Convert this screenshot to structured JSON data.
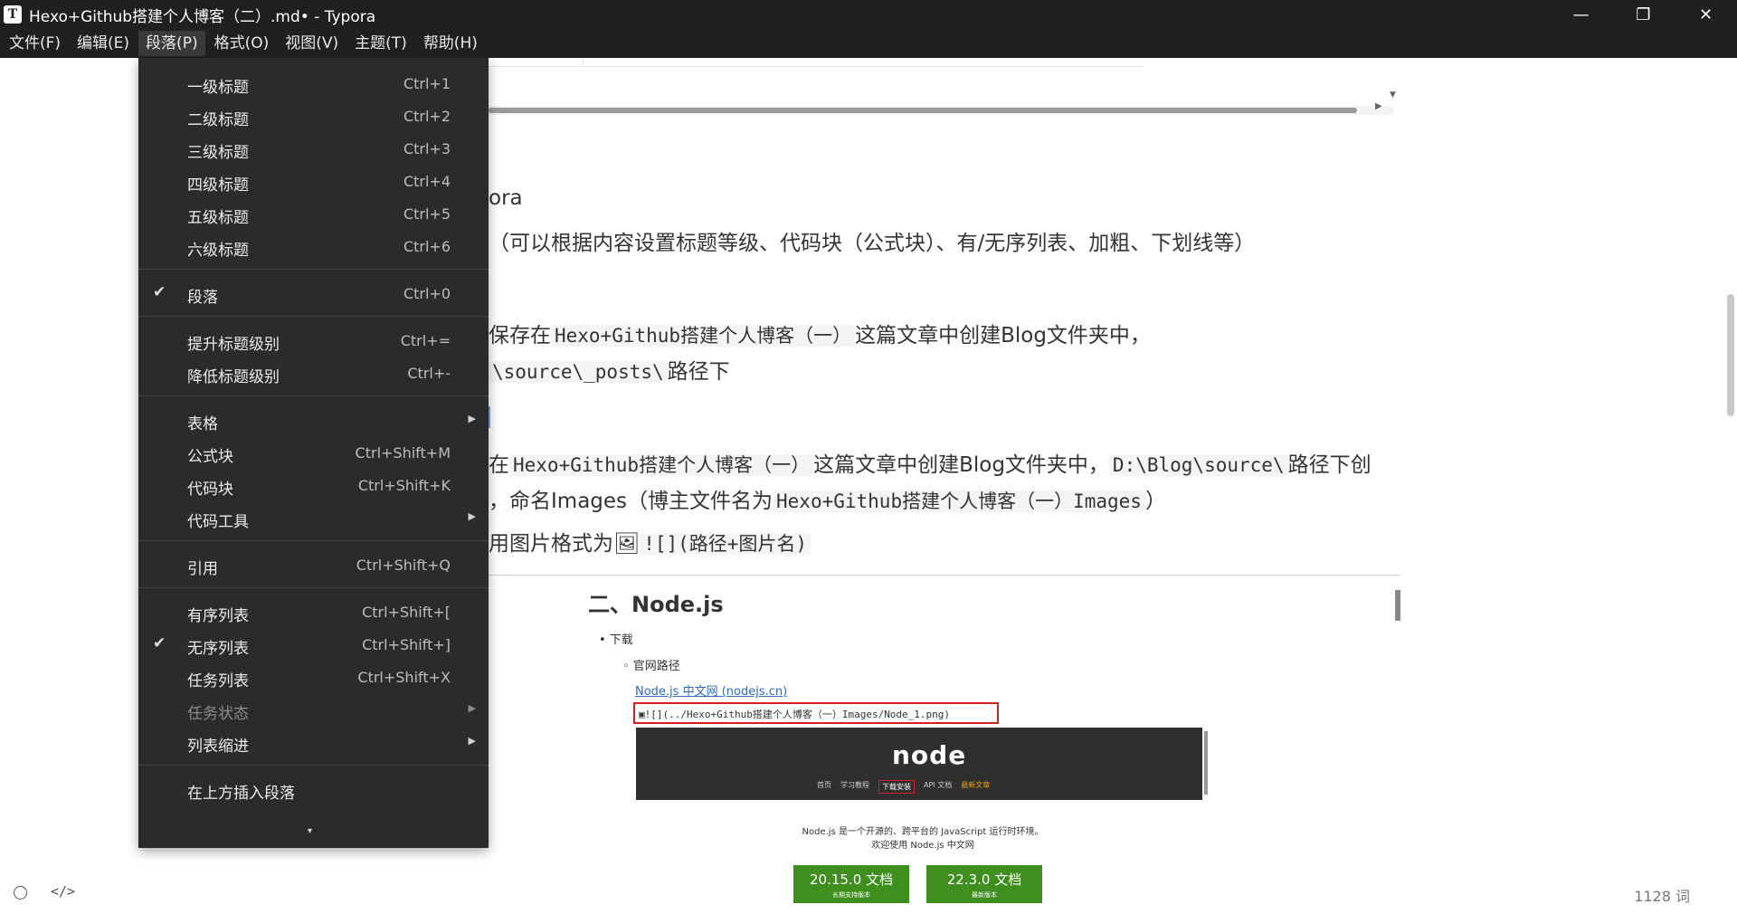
{
  "window": {
    "title": "Hexo+Github搭建个人博客（二）.md• - Typora",
    "app_icon": "T",
    "minimize": "—",
    "maximize": "❐",
    "close": "✕"
  },
  "menubar": [
    "文件(F)",
    "编辑(E)",
    "段落(P)",
    "格式(O)",
    "视图(V)",
    "主题(T)",
    "帮助(H)"
  ],
  "dropdown": {
    "items": [
      {
        "label": "一级标题",
        "shortcut": "Ctrl+1"
      },
      {
        "label": "二级标题",
        "shortcut": "Ctrl+2"
      },
      {
        "label": "三级标题",
        "shortcut": "Ctrl+3"
      },
      {
        "label": "四级标题",
        "shortcut": "Ctrl+4"
      },
      {
        "label": "五级标题",
        "shortcut": "Ctrl+5"
      },
      {
        "label": "六级标题",
        "shortcut": "Ctrl+6"
      },
      {
        "label": "段落",
        "shortcut": "Ctrl+0",
        "checked": true
      },
      {
        "label": "提升标题级别",
        "shortcut": "Ctrl+="
      },
      {
        "label": "降低标题级别",
        "shortcut": "Ctrl+-"
      },
      {
        "label": "表格",
        "shortcut": "",
        "submenu": true
      },
      {
        "label": "公式块",
        "shortcut": "Ctrl+Shift+M"
      },
      {
        "label": "代码块",
        "shortcut": "Ctrl+Shift+K"
      },
      {
        "label": "代码工具",
        "shortcut": "",
        "submenu": true
      },
      {
        "label": "引用",
        "shortcut": "Ctrl+Shift+Q"
      },
      {
        "label": "有序列表",
        "shortcut": "Ctrl+Shift+["
      },
      {
        "label": "无序列表",
        "shortcut": "Ctrl+Shift+]",
        "checked": true
      },
      {
        "label": "任务列表",
        "shortcut": "Ctrl+Shift+X"
      },
      {
        "label": "任务状态",
        "shortcut": "",
        "submenu": true,
        "disabled": true
      },
      {
        "label": "列表缩进",
        "shortcut": "",
        "submenu": true
      },
      {
        "label": "在上方插入段落",
        "shortcut": ""
      }
    ],
    "check_glyph": "✔",
    "arrow_glyph": "▶",
    "more_glyph": "▾"
  },
  "doc": {
    "l1": "ora",
    "l2": "（可以根据内容设置标题等级、代码块（公式块）、有/无序列表、加粗、下划线等）",
    "l3_pre": "保存在",
    "l3_code": "Hexo+Github搭建个人博客（一）",
    "l3_post": "这篇文章中创建Blog文件夹中，",
    "l4_code": "\\source\\_posts\\",
    "l4_post": "路径下",
    "l5_pre": "在",
    "l5_code1": "Hexo+Github搭建个人博客（一）",
    "l5_mid": "这篇文章中创建Blog文件夹中，",
    "l5_code2": "D:\\Blog\\source\\",
    "l5_post": "路径下创",
    "l6_pre": "，命名Images（博主文件名为",
    "l6_code": "Hexo+Github搭建个人博客（一）Images",
    "l6_post": "）",
    "l7_pre": "用图片格式为",
    "l7_icon": "🖼",
    "l7_code": "![](路径+图片名)"
  },
  "embed": {
    "title": "二、Node.js",
    "bullet1": "• 下载",
    "bullet2": "◦ 官网路径",
    "link": "Node.js 中文网 (nodejs.cn)",
    "code": "![](../Hexo+Github搭建个人博客（一）Images/Node_1.png)",
    "node_logo": "node",
    "nav": [
      "首页",
      "学习教程",
      "下载安装",
      "API 文档",
      "最新文章"
    ],
    "desc1": "Node.js 是一个开源的、跨平台的 JavaScript 运行时环境。",
    "desc2": "欢迎使用 Node.js 中文网",
    "btn1_v": "20.15.0 文档",
    "btn1_s": "长期支持版本",
    "btn2_v": "22.3.0 文档",
    "btn2_s": "最新版本"
  },
  "status": {
    "code_glyph": "</>",
    "word_count": "1128 词"
  }
}
